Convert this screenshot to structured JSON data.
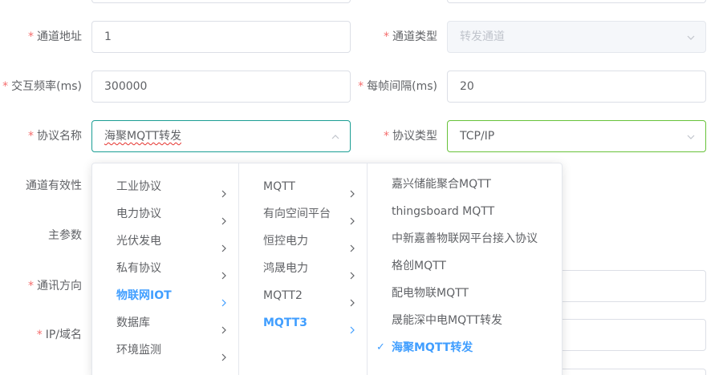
{
  "form": {
    "channel_address": {
      "label": "通道地址",
      "required": true,
      "value": "1"
    },
    "channel_type": {
      "label": "通道类型",
      "required": true,
      "value": "转发通道"
    },
    "interaction_freq": {
      "label": "交互频率(ms)",
      "required": true,
      "value": "300000"
    },
    "frame_interval": {
      "label": "每帧间隔(ms)",
      "required": true,
      "value": "20"
    },
    "protocol_name": {
      "label": "协议名称",
      "required": true,
      "value": "海聚MQTT转发"
    },
    "protocol_type": {
      "label": "协议类型",
      "required": true,
      "value": "TCP/IP"
    },
    "channel_validity": {
      "label": "通道有效性",
      "required": false
    },
    "main_params": {
      "label": "主参数",
      "required": false
    },
    "comm_direction": {
      "label": "通讯方向",
      "required": true
    },
    "ip_domain": {
      "label": "IP/域名",
      "required": true
    }
  },
  "cascader": {
    "col1": [
      {
        "label": "工业协议",
        "active": false
      },
      {
        "label": "电力协议",
        "active": false
      },
      {
        "label": "光伏发电",
        "active": false
      },
      {
        "label": "私有协议",
        "active": false
      },
      {
        "label": "物联网IOT",
        "active": true
      },
      {
        "label": "数据库",
        "active": false
      },
      {
        "label": "环境监测",
        "active": false
      }
    ],
    "col2": [
      {
        "label": "MQTT",
        "active": false
      },
      {
        "label": "有向空间平台",
        "active": false
      },
      {
        "label": "恒控电力",
        "active": false
      },
      {
        "label": "鸿晟电力",
        "active": false
      },
      {
        "label": "MQTT2",
        "active": false
      },
      {
        "label": "MQTT3",
        "active": true
      }
    ],
    "col3": [
      {
        "label": "嘉兴储能聚合MQTT",
        "selected": false
      },
      {
        "label": "thingsboard MQTT",
        "selected": false
      },
      {
        "label": "中新嘉善物联网平台接入协议",
        "selected": false
      },
      {
        "label": "格创MQTT",
        "selected": false
      },
      {
        "label": "配电物联MQTT",
        "selected": false
      },
      {
        "label": "晟能深中电MQTT转发",
        "selected": false
      },
      {
        "label": "海聚MQTT转发",
        "selected": true
      }
    ]
  },
  "colors": {
    "primary": "#409eff",
    "required": "#f56c6c",
    "focus_teal": "#1b9e94",
    "focus_green": "#67c23a"
  },
  "icons": {
    "dropdown": "chevron-down-icon",
    "dropdown_open": "chevron-up-icon",
    "submenu": "chevron-right-icon",
    "selected": "check-icon"
  }
}
